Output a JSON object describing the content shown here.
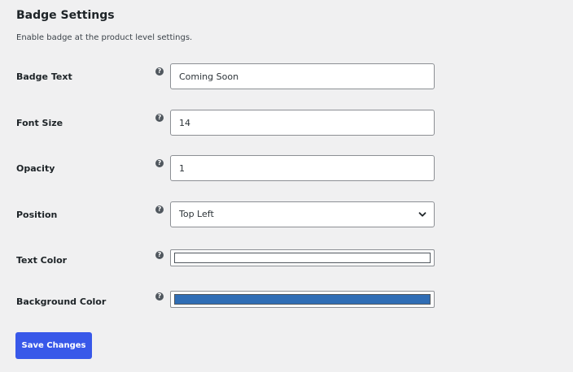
{
  "section": {
    "title": "Badge Settings",
    "description": "Enable badge at the product level settings."
  },
  "help_icon_glyph": "?",
  "fields": {
    "badge_text": {
      "label": "Badge Text",
      "value": "Coming Soon"
    },
    "font_size": {
      "label": "Font Size",
      "value": "14"
    },
    "opacity": {
      "label": "Opacity",
      "value": "1"
    },
    "position": {
      "label": "Position",
      "selected": "Top Left"
    },
    "text_color": {
      "label": "Text Color",
      "color": "#ffffff"
    },
    "background_color": {
      "label": "Background Color",
      "color": "#2f6db5"
    }
  },
  "actions": {
    "save_label": "Save Changes"
  },
  "colors": {
    "page_background": "#f0f0f1",
    "primary_button": "#3858e9",
    "help_icon": "#50575e"
  },
  "icons": {
    "help": "help-icon",
    "select_arrow": "chevron-down-icon"
  }
}
